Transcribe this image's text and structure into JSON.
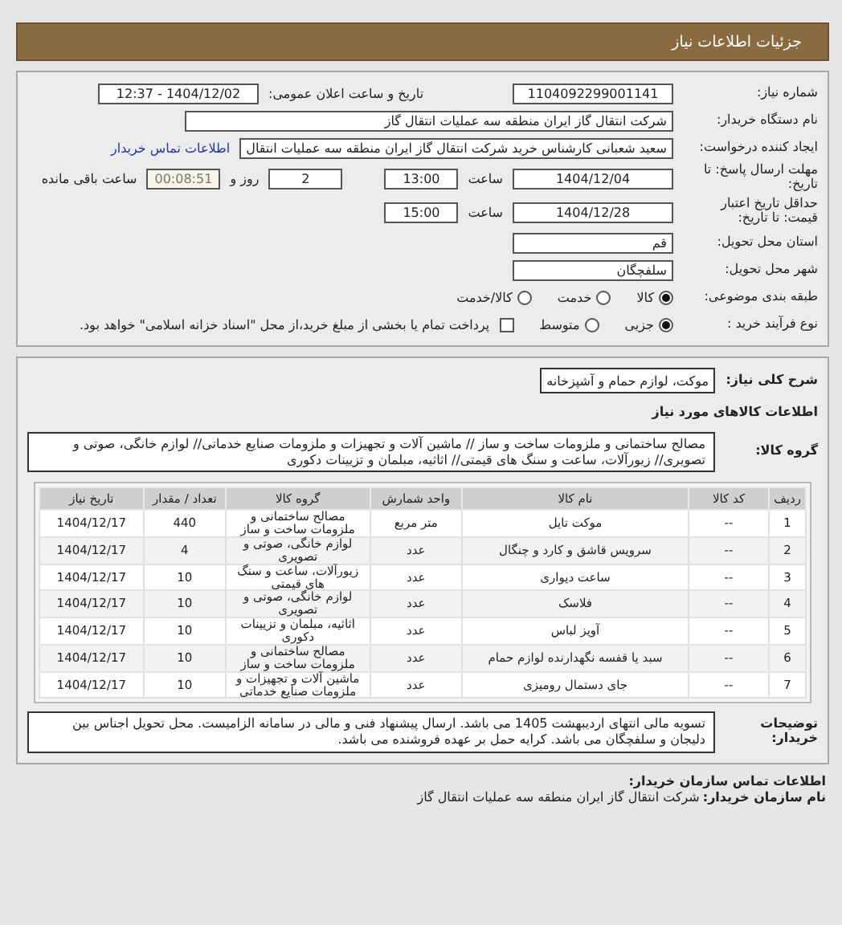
{
  "header": {
    "title": "جزئیات اطلاعات نیاز"
  },
  "need_number": {
    "label": "شماره نیاز:",
    "value": "1104092299001141"
  },
  "announce": {
    "label": "تاریخ و ساعت اعلان عمومی:",
    "value": "1404/12/02 - 12:37"
  },
  "buyer": {
    "label": "نام دستگاه خریدار:",
    "value": "شرکت انتقال گاز ایران منطقه سه عملیات انتقال گاز"
  },
  "requester": {
    "label": "ایجاد کننده درخواست:",
    "value": "سعید شعبانی کارشناس خرید شرکت انتقال گاز ایران منطقه سه عملیات انتقال",
    "link": "اطلاعات تماس خریدار"
  },
  "deadline": {
    "label": "مهلت ارسال پاسخ: تا تاریخ:",
    "date": "1404/12/04",
    "time_label": "ساعت",
    "time": "13:00",
    "days": "2",
    "days_label": "روز و",
    "remaining": "00:08:51",
    "remaining_label": "ساعت باقی مانده"
  },
  "validity": {
    "label": "حداقل تاریخ اعتبار قیمت: تا تاریخ:",
    "date": "1404/12/28",
    "time_label": "ساعت",
    "time": "15:00"
  },
  "province": {
    "label": "استان محل تحویل:",
    "value": "قم"
  },
  "city": {
    "label": "شهر محل تحویل:",
    "value": "سلفچگان"
  },
  "category": {
    "label": "طبقه بندی موضوعی:",
    "options": [
      {
        "label": "کالا",
        "selected": true
      },
      {
        "label": "خدمت",
        "selected": false
      },
      {
        "label": "کالا/خدمت",
        "selected": false
      }
    ]
  },
  "process": {
    "label": "نوع فرآیند خرید :",
    "options": [
      {
        "label": "جزیی",
        "selected": true
      },
      {
        "label": "متوسط",
        "selected": false
      }
    ],
    "payment": {
      "checked": false,
      "label": "پرداخت تمام یا بخشی از مبلغ خرید،از محل \"اسناد خزانه اسلامی\" خواهد بود."
    }
  },
  "summary": {
    "label": "شرح کلی نیاز:",
    "value": "موکت، لوازم حمام و آشپزخانه"
  },
  "goods_heading": "اطلاعات کالاهای مورد نیاز",
  "goods_group": {
    "label": "گروه کالا:",
    "value": "مصالح ساختمانی و ملزومات ساخت و ساز // ماشین آلات و تجهیزات و ملزومات صنایع خدماتی// لوازم خانگی، صوتی و تصویری// زیورآلات، ساعت و سنگ های قیمتی// اثاثیه، مبلمان و تزیینات دکوری"
  },
  "table": {
    "columns": [
      "ردیف",
      "کد کالا",
      "نام کالا",
      "واحد شمارش",
      "گروه کالا",
      "تعداد / مقدار",
      "تاریخ نیاز"
    ],
    "rows": [
      {
        "cells": [
          "1",
          "--",
          "موکت تایل",
          "متر مربع",
          "مصالح ساختمانی و ملزومات ساخت و ساز",
          "440",
          "1404/12/17"
        ]
      },
      {
        "cells": [
          "2",
          "--",
          "سرویس قاشق و کارد و چنگال",
          "عدد",
          "لوازم خانگی، صوتی و تصویری",
          "4",
          "1404/12/17"
        ]
      },
      {
        "cells": [
          "3",
          "--",
          "ساعت دیواری",
          "عدد",
          "زیورآلات، ساعت و سنگ های قیمتی",
          "10",
          "1404/12/17"
        ]
      },
      {
        "cells": [
          "4",
          "--",
          "فلاسک",
          "عدد",
          "لوازم خانگی، صوتی و تصویری",
          "10",
          "1404/12/17"
        ]
      },
      {
        "cells": [
          "5",
          "--",
          "آویز لباس",
          "عدد",
          "اثاثیه، مبلمان و تزیینات دکوری",
          "10",
          "1404/12/17"
        ]
      },
      {
        "cells": [
          "6",
          "--",
          "سبد یا قفسه نگهدارنده لوازم حمام",
          "عدد",
          "مصالح ساختمانی و ملزومات ساخت و ساز",
          "10",
          "1404/12/17"
        ]
      },
      {
        "cells": [
          "7",
          "--",
          "جای دستمال رومیزی",
          "عدد",
          "ماشین آلات و تجهیزات و ملزومات صنایع خدماتی",
          "10",
          "1404/12/17"
        ]
      }
    ]
  },
  "notes": {
    "label": "توضیحات خریدار:",
    "value": "تسویه مالی انتهای اردیبهشت 1405 می باشد. ارسال پیشنهاد فنی و مالی در سامانه الزامیست. محل تحویل اجناس بین دلیجان و سلفچگان می باشد. کرایه حمل بر عهده فروشنده می باشد."
  },
  "contact": {
    "heading": "اطلاعات تماس سازمان خریدار:",
    "org_label": "نام سازمان خریدار:",
    "org": "شرکت انتقال گاز ایران منطقه سه عملیات انتقال گاز"
  }
}
